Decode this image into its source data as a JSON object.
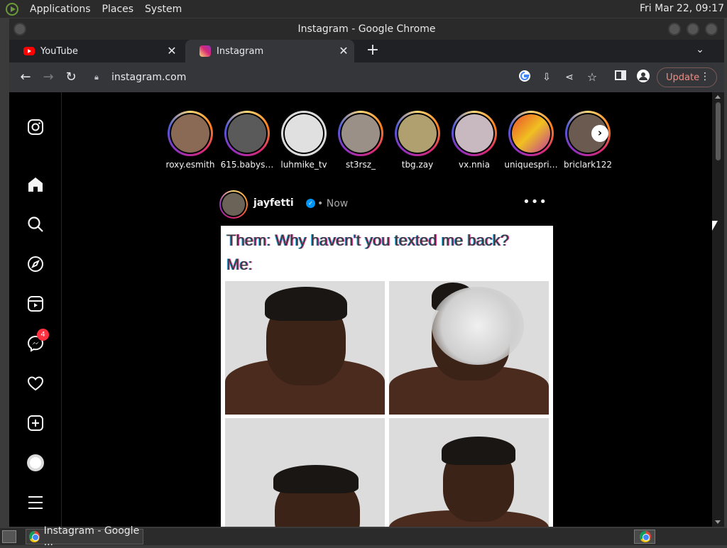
{
  "desktop": {
    "menu": [
      "Applications",
      "Places",
      "System"
    ],
    "clock": "Fri Mar 22, 09:17"
  },
  "window": {
    "title": "Instagram - Google Chrome"
  },
  "tabs": [
    {
      "label": "YouTube",
      "icon": "youtube-icon",
      "active": false
    },
    {
      "label": "Instagram",
      "icon": "instagram-icon",
      "active": true
    }
  ],
  "toolbar": {
    "url": "instagram.com",
    "update_label": "Update"
  },
  "stories": [
    {
      "name": "roxy.esmith",
      "color": "#8a6a55"
    },
    {
      "name": "615.babys…",
      "color": "#5a5a5a"
    },
    {
      "name": "luhmike_tv",
      "color": "#e0e0e0"
    },
    {
      "name": "st3rsz_",
      "color": "#9a9088"
    },
    {
      "name": "tbg.zay",
      "color": "#b0a070"
    },
    {
      "name": "vx.nnia",
      "color": "#c8b8c0"
    },
    {
      "name": "uniquespri…",
      "color": "#d8553a"
    },
    {
      "name": "briclark122",
      "color": "#6a5a50"
    }
  ],
  "post": {
    "username": "jayfetti",
    "separator": "•",
    "time": "Now",
    "meme_line1": "Them: Why haven't you texted me back?",
    "meme_line2": "Me:"
  },
  "nav": {
    "messages_badge": "4"
  },
  "taskbar": {
    "item_label": "Instagram - Google ..."
  }
}
